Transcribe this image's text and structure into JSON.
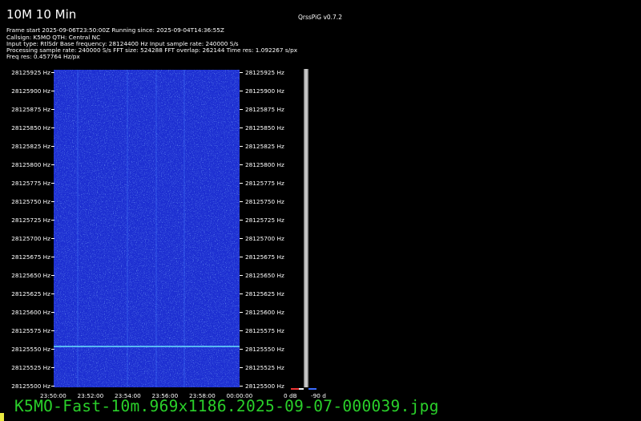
{
  "header": {
    "title": "10M 10 Min",
    "version": "QrssPiG v0.7.2",
    "info_lines": [
      "Frame start 2025-09-06T23:50:00Z Running since: 2025-09-04T14:36:55Z",
      "Callsign: K5MO QTH: Central NC",
      "Input type: RtlSdr Base frequency: 28124400 Hz Input sample rate: 240000 S/s",
      "Processing sample rate: 240000 S/s FFT size: 524288 FFT overlap: 262144 Time res: 1.092267 s/px",
      "Freq res: 0.457764 Hz/px"
    ]
  },
  "chart_data": {
    "type": "heatmap",
    "y_ticks": [
      "28125925 Hz",
      "28125900 Hz",
      "28125875 Hz",
      "28125850 Hz",
      "28125825 Hz",
      "28125800 Hz",
      "28125775 Hz",
      "28125750 Hz",
      "28125725 Hz",
      "28125700 Hz",
      "28125675 Hz",
      "28125650 Hz",
      "28125625 Hz",
      "28125600 Hz",
      "28125575 Hz",
      "28125550 Hz",
      "28125525 Hz",
      "28125500 Hz"
    ],
    "x_ticks": [
      "23:50:00",
      "23:52:00",
      "23:54:00",
      "23:56:00",
      "23:58:00",
      "00:00:00"
    ],
    "ylim": [
      28125500,
      28125935
    ],
    "signal_frequency_hz": 28125556,
    "colorbar_labels": [
      "0 dB",
      "-90 d"
    ],
    "colors": {
      "background": "#1d2fd1",
      "noise": "#3f78ff",
      "signal": "#6ff0ff"
    }
  },
  "footer": {
    "filename": "K5MO-Fast-10m.969x1186.2025-09-07-000039.jpg"
  }
}
